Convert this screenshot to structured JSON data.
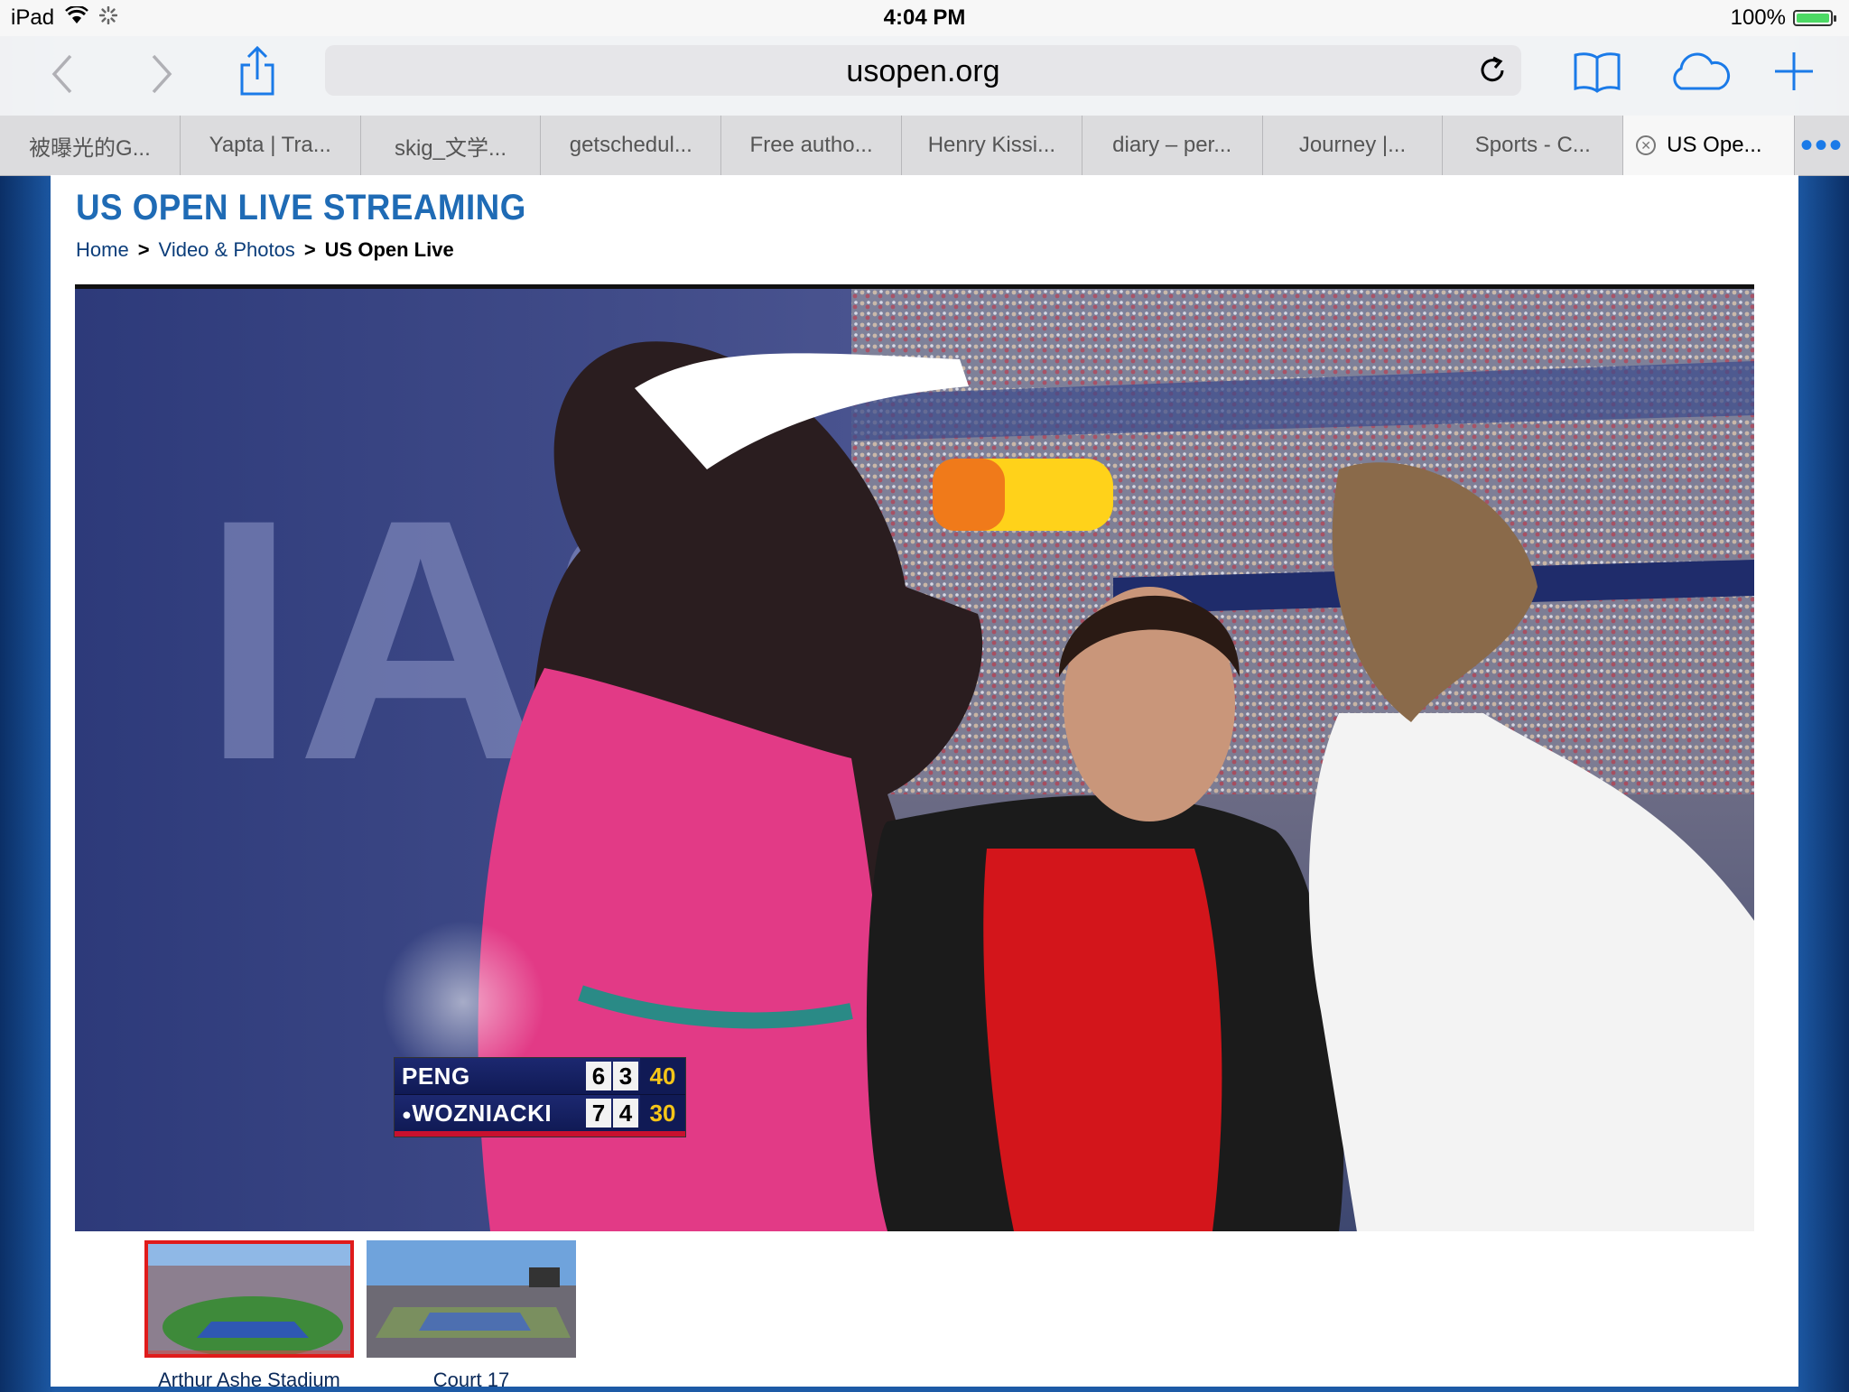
{
  "status_bar": {
    "device": "iPad",
    "time": "4:04 PM",
    "battery_text": "100%",
    "battery_level": 1.0,
    "icons": [
      "wifi-icon",
      "activity-spinner-icon",
      "battery-icon"
    ]
  },
  "toolbar": {
    "url": "usopen.org",
    "buttons": [
      "back-icon",
      "forward-icon",
      "share-icon",
      "reload-icon",
      "bookmarks-icon",
      "icloud-tabs-icon",
      "new-tab-icon"
    ]
  },
  "tabs": [
    {
      "label": "被曝光的G..."
    },
    {
      "label": "Yapta | Tra..."
    },
    {
      "label": "skig_文学..."
    },
    {
      "label": "getschedul..."
    },
    {
      "label": "Free autho..."
    },
    {
      "label": "Henry Kissi..."
    },
    {
      "label": "diary – per..."
    },
    {
      "label": "Journey |..."
    },
    {
      "label": "Sports - C..."
    },
    {
      "label": "US Ope...",
      "active": true
    }
  ],
  "tab_more": "•••",
  "page": {
    "title": "US OPEN LIVE STREAMING",
    "breadcrumb": {
      "home": "Home",
      "section": "Video & Photos",
      "current": "US Open Live",
      "separator": ">"
    }
  },
  "video": {
    "scoreboard": {
      "players": [
        {
          "name": "PENG",
          "set1": "6",
          "set2": "3",
          "points": "40",
          "serving": false
        },
        {
          "name": "WOZNIACKI",
          "set1": "7",
          "set2": "4",
          "points": "30",
          "serving": true
        }
      ]
    }
  },
  "courts": [
    {
      "label": "Arthur Ashe Stadium",
      "selected": true
    },
    {
      "label": "Court 17",
      "selected": false
    }
  ],
  "colors": {
    "accent": "#1f6bb5",
    "page_background": "#1d5aa6",
    "selected_border": "#e01b1b",
    "score_gold": "#f5c518",
    "ios_blue": "#1a7ae8"
  }
}
